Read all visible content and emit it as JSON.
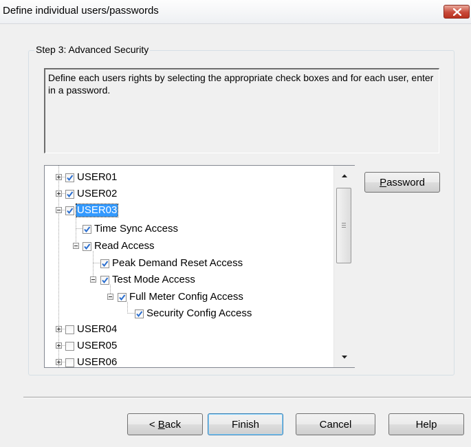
{
  "window": {
    "title": "Define individual users/passwords",
    "close_icon": "close-x-icon",
    "close_color": "#c8493a"
  },
  "group": {
    "legend": "Step 3: Advanced Security",
    "description": "Define each users rights by selecting the appropriate check boxes and for each user, enter in a password."
  },
  "tree": {
    "nodes": [
      {
        "label": "USER01",
        "checked": true,
        "expander": "plus"
      },
      {
        "label": "USER02",
        "checked": true,
        "expander": "plus"
      },
      {
        "label": "USER03",
        "checked": true,
        "expander": "minus",
        "selected": true
      },
      {
        "label": "Time Sync Access",
        "checked": true
      },
      {
        "label": "Read Access",
        "checked": true,
        "expander": "minus"
      },
      {
        "label": "Peak Demand Reset Access",
        "checked": true
      },
      {
        "label": "Test Mode Access",
        "checked": true,
        "expander": "minus"
      },
      {
        "label": "Full Meter Config Access",
        "checked": true,
        "expander": "minus"
      },
      {
        "label": "Security Config Access",
        "checked": true
      },
      {
        "label": "USER04",
        "checked": false,
        "expander": "plus"
      },
      {
        "label": "USER05",
        "checked": false,
        "expander": "plus"
      },
      {
        "label": "USER06",
        "checked": false,
        "expander": "plus"
      }
    ],
    "check_color": "#2a6ecf"
  },
  "buttons": {
    "password": {
      "pre": "",
      "mnemonic": "P",
      "post": "assword"
    },
    "back": {
      "pre": "< ",
      "mnemonic": "B",
      "post": "ack"
    },
    "finish": "Finish",
    "cancel": "Cancel",
    "help": "Help"
  }
}
